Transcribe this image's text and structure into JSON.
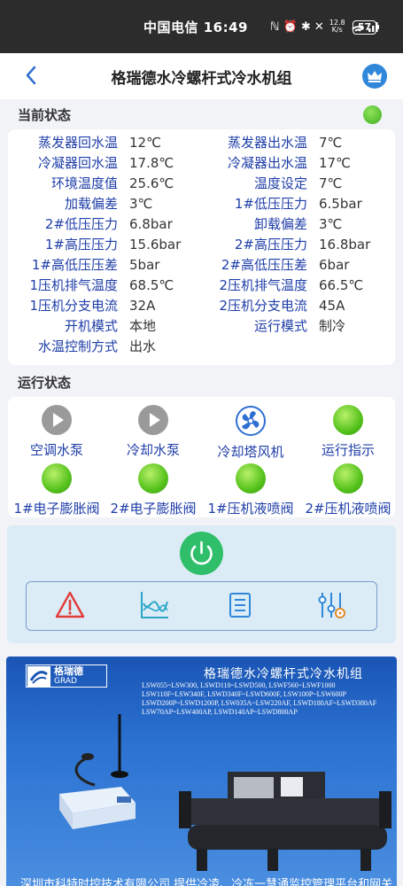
{
  "status_bar": {
    "carrier_time": "中国电信 16:49",
    "icons": "ℕ ⏰ ✱ ✕",
    "speed_value": "12.8",
    "speed_unit": "K/s",
    "battery": "57"
  },
  "header": {
    "title": "格瑞德水冷螺杆式冷水机组"
  },
  "current_status": {
    "section_title": "当前状态",
    "rows": [
      {
        "l1": "蒸发器回水温",
        "v1": "12℃",
        "l2": "蒸发器出水温",
        "v2": "7℃"
      },
      {
        "l1": "冷凝器回水温",
        "v1": "17.8℃",
        "l2": "冷凝器出水温",
        "v2": "17℃"
      },
      {
        "l1": "环境温度值",
        "v1": "25.6℃",
        "l2": "温度设定",
        "v2": "7℃"
      },
      {
        "l1": "加载偏差",
        "v1": "3℃",
        "l2": "1#低压压力",
        "v2": "6.5bar"
      },
      {
        "l1": "2#低压压力",
        "v1": "6.8bar",
        "l2": "卸载偏差",
        "v2": "3℃"
      },
      {
        "l1": "1#高压压力",
        "v1": "15.6bar",
        "l2": "2#高压压力",
        "v2": "16.8bar"
      },
      {
        "l1": "1#高低压压差",
        "v1": "5bar",
        "l2": "2#高低压压差",
        "v2": "6bar"
      },
      {
        "l1": "1压机排气温度",
        "v1": "68.5℃",
        "l2": "2压机排气温度",
        "v2": "66.5℃"
      },
      {
        "l1": "1压机分支电流",
        "v1": "32A",
        "l2": "2压机分支电流",
        "v2": "45A"
      },
      {
        "l1": "开机模式",
        "v1": "本地",
        "l2": "运行模式",
        "v2": "制冷"
      },
      {
        "l1": "水温控制方式",
        "v1": "出水",
        "l2": "",
        "v2": ""
      }
    ]
  },
  "run_status": {
    "section_title": "运行状态",
    "items": [
      {
        "label": "空调水泵",
        "icon": "play-icon"
      },
      {
        "label": "冷却水泵",
        "icon": "play-icon"
      },
      {
        "label": "冷却塔风机",
        "icon": "fan-icon"
      },
      {
        "label": "运行指示",
        "icon": "green-light-icon"
      },
      {
        "label": "1#电子膨胀阀",
        "icon": "green-light-icon"
      },
      {
        "label": "2#电子膨胀阀",
        "icon": "green-light-icon"
      },
      {
        "label": "1#压机液喷阀",
        "icon": "green-light-icon"
      },
      {
        "label": "2#压机液喷阀",
        "icon": "green-light-icon"
      }
    ]
  },
  "colors": {
    "label_blue": "#1f3ea8",
    "indicator_green": "#55c21c",
    "power_green": "#2fbf6a",
    "header_accent": "#2f87d9"
  },
  "banner": {
    "logo_cn": "格瑞德",
    "logo_en": "GRAD",
    "title": "格瑞德水冷螺杆式冷水机组",
    "models": [
      "LSW055~LSW300, LSWD110~LSWD500, LSWF560~LSWF1000",
      "LSW110F~LSW340F, LSWD340F~LSWD600F, LSW100P~LSW600P",
      "LSWD200P~LSWD1200P, LSW035A~LSW220AF, LSWD180AF~LSWD380AF",
      "LSW70AP~LSW400AP, LSWD140AP~LSWD800AP"
    ],
    "footer": "深圳市科特时控技术有限公司   提供冷凌、冷冻一慧通监控管理平台和网关"
  }
}
